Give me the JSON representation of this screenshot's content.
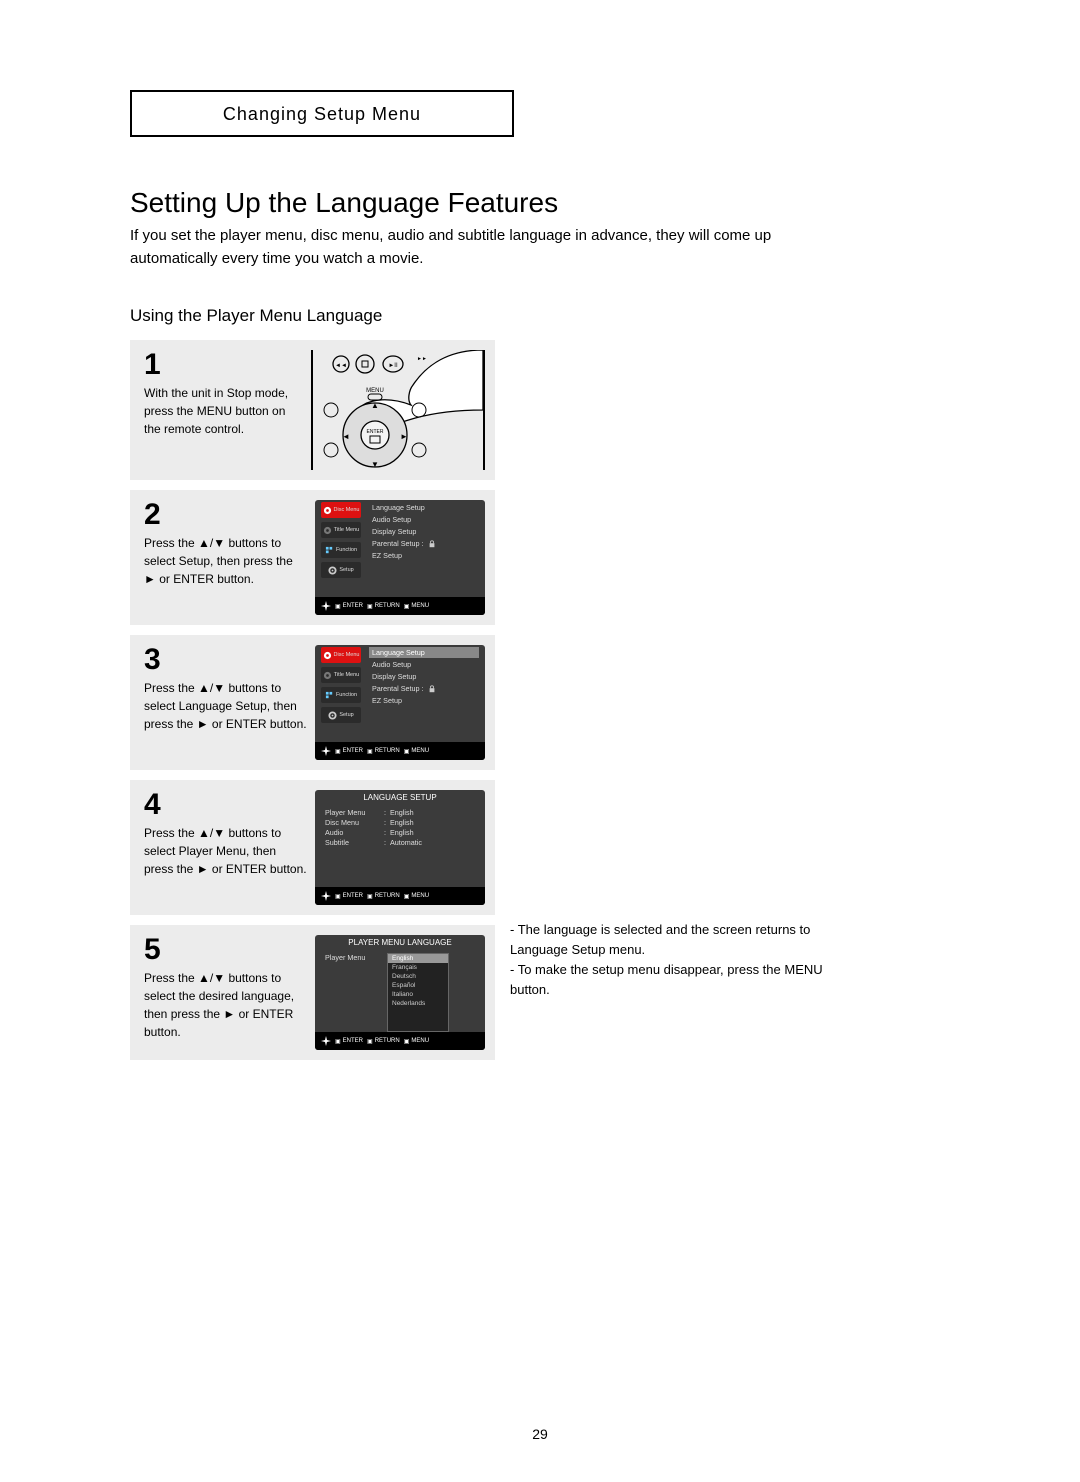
{
  "chapter": "Changing Setup Menu",
  "title": "Setting Up the Language Features",
  "intro": "If you set the player menu, disc menu, audio and subtitle language in advance, they will come up automatically every time you watch a movie.",
  "subtitle": "Using the Player Menu Language",
  "steps": {
    "s1": {
      "num": "1",
      "text": "With the unit in Stop mode, press the MENU button on the remote control."
    },
    "s2": {
      "num": "2",
      "text": "Press the ▲/▼ buttons to select Setup, then press the ► or ENTER button."
    },
    "s3": {
      "num": "3",
      "text": "Press the ▲/▼ buttons to select Language Setup, then press the ► or ENTER button."
    },
    "s4": {
      "num": "4",
      "text": "Press the ▲/▼ buttons to select Player Menu, then press the ► or ENTER button."
    },
    "s5": {
      "num": "5",
      "text": "Press the ▲/▼ buttons to select the desired language, then press the ► or ENTER button."
    }
  },
  "screens": {
    "setup_list": {
      "items": [
        "Language Setup",
        "Audio Setup",
        "Display Setup",
        "Parental Setup :",
        "EZ Setup"
      ],
      "sidebar": [
        "Disc Menu",
        "Title Menu",
        "Function",
        "Setup"
      ]
    },
    "lang_setup": {
      "header": "LANGUAGE SETUP",
      "rows": [
        {
          "label": "Player Menu",
          "val": "English"
        },
        {
          "label": "Disc Menu",
          "val": "English"
        },
        {
          "label": "Audio",
          "val": "English"
        },
        {
          "label": "Subtitle",
          "val": "Automatic"
        }
      ]
    },
    "player_lang": {
      "header": "PLAYER MENU LANGUAGE",
      "label": "Player Menu",
      "options": [
        "English",
        "Français",
        "Deutsch",
        "Español",
        "Italiano",
        "Nederlands"
      ]
    },
    "footer": {
      "enter": "ENTER",
      "return": "RETURN",
      "menu": "MENU"
    }
  },
  "sidenote_a": "- The language is selected and the screen returns to Language Setup menu.",
  "sidenote_b": "- To make the setup menu disappear, press the MENU button.",
  "pagenum": "29"
}
